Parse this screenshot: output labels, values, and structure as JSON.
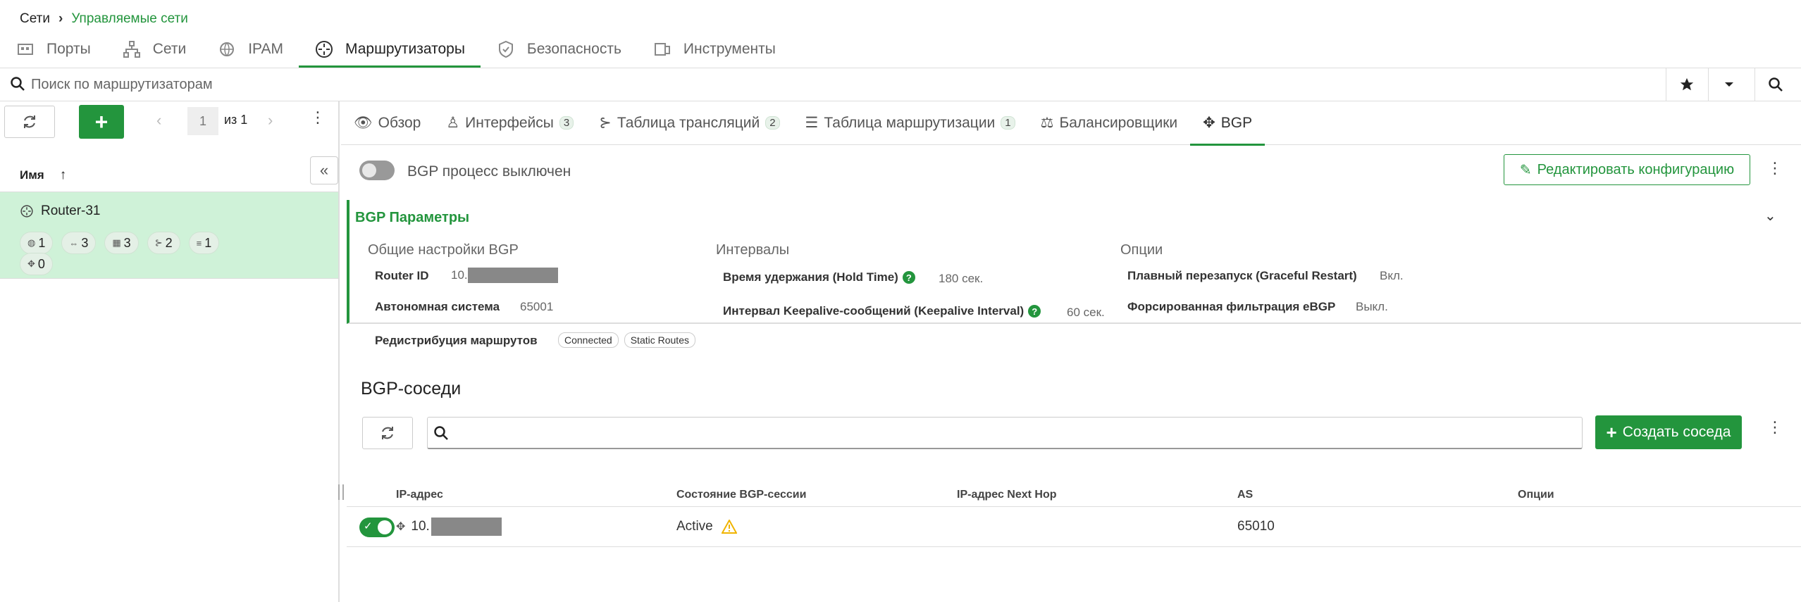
{
  "breadcrumb": {
    "root": "Сети",
    "current": "Управляемые сети"
  },
  "top_tabs": [
    {
      "label": "Порты",
      "icon": "ports-icon"
    },
    {
      "label": "Сети",
      "icon": "network-icon"
    },
    {
      "label": "IPAM",
      "icon": "ipam-icon"
    },
    {
      "label": "Маршрутизаторы",
      "icon": "router-icon",
      "active": true
    },
    {
      "label": "Безопасность",
      "icon": "shield-icon"
    },
    {
      "label": "Инструменты",
      "icon": "tools-icon"
    }
  ],
  "search": {
    "placeholder": "Поиск по маршрутизаторам"
  },
  "left_panel": {
    "pagination": {
      "page": "1",
      "of_label": "из 1"
    },
    "column_header": "Имя",
    "router": {
      "name": "Router-31",
      "chips": [
        {
          "icon": "globe-icon",
          "count": "1"
        },
        {
          "icon": "interface-icon",
          "count": "3"
        },
        {
          "icon": "server-icon",
          "count": "3"
        },
        {
          "icon": "nat-icon",
          "count": "2"
        },
        {
          "icon": "list-icon",
          "count": "1"
        },
        {
          "icon": "handshake-icon",
          "count": "0"
        }
      ]
    }
  },
  "right_tabs": [
    {
      "label": "Обзор",
      "icon": "eye-icon"
    },
    {
      "label": "Интерфейсы",
      "icon": "interface-icon",
      "badge": "3"
    },
    {
      "label": "Таблица трансляций",
      "icon": "nat-icon",
      "badge": "2"
    },
    {
      "label": "Таблица маршрутизации",
      "icon": "list-icon",
      "badge": "1"
    },
    {
      "label": "Балансировщики",
      "icon": "balance-icon"
    },
    {
      "label": "BGP",
      "icon": "handshake-icon",
      "active": true
    }
  ],
  "bgp": {
    "process_label": "BGP процесс выключен",
    "process_enabled": false,
    "edit_button": "Редактировать конфигурацию",
    "params_title": "BGP Параметры",
    "general": {
      "title": "Общие настройки BGP",
      "router_id_label": "Router ID",
      "router_id_value": "10.",
      "as_label": "Автономная система",
      "as_value": "65001",
      "redistribution_label": "Редистрибуция маршрутов",
      "redistribution_tags": [
        "Connected",
        "Static Routes"
      ]
    },
    "intervals": {
      "title": "Интервалы",
      "hold_label": "Время удержания (Hold Time)",
      "hold_value": "180 сек.",
      "keepalive_label": "Интервал Keepalive-сообщений (Keepalive Interval)",
      "keepalive_value": "60 сек."
    },
    "options": {
      "title": "Опции",
      "graceful_label": "Плавный перезапуск (Graceful Restart)",
      "graceful_value": "Вкл.",
      "ebgp_label": "Форсированная фильтрация eBGP",
      "ebgp_value": "Выкл."
    }
  },
  "neighbors": {
    "title": "BGP-соседи",
    "create_button": "Создать соседа",
    "columns": [
      "IP-адрес",
      "Состояние BGP-сессии",
      "IP-адрес Next Hop",
      "AS",
      "Опции"
    ],
    "rows": [
      {
        "enabled": true,
        "ip": "10.",
        "state": "Active",
        "next_hop": "",
        "as": "65010",
        "options": ""
      }
    ]
  },
  "colors": {
    "accent": "#23953d",
    "selected_row": "#cff2d8",
    "warning": "#f0b400"
  }
}
